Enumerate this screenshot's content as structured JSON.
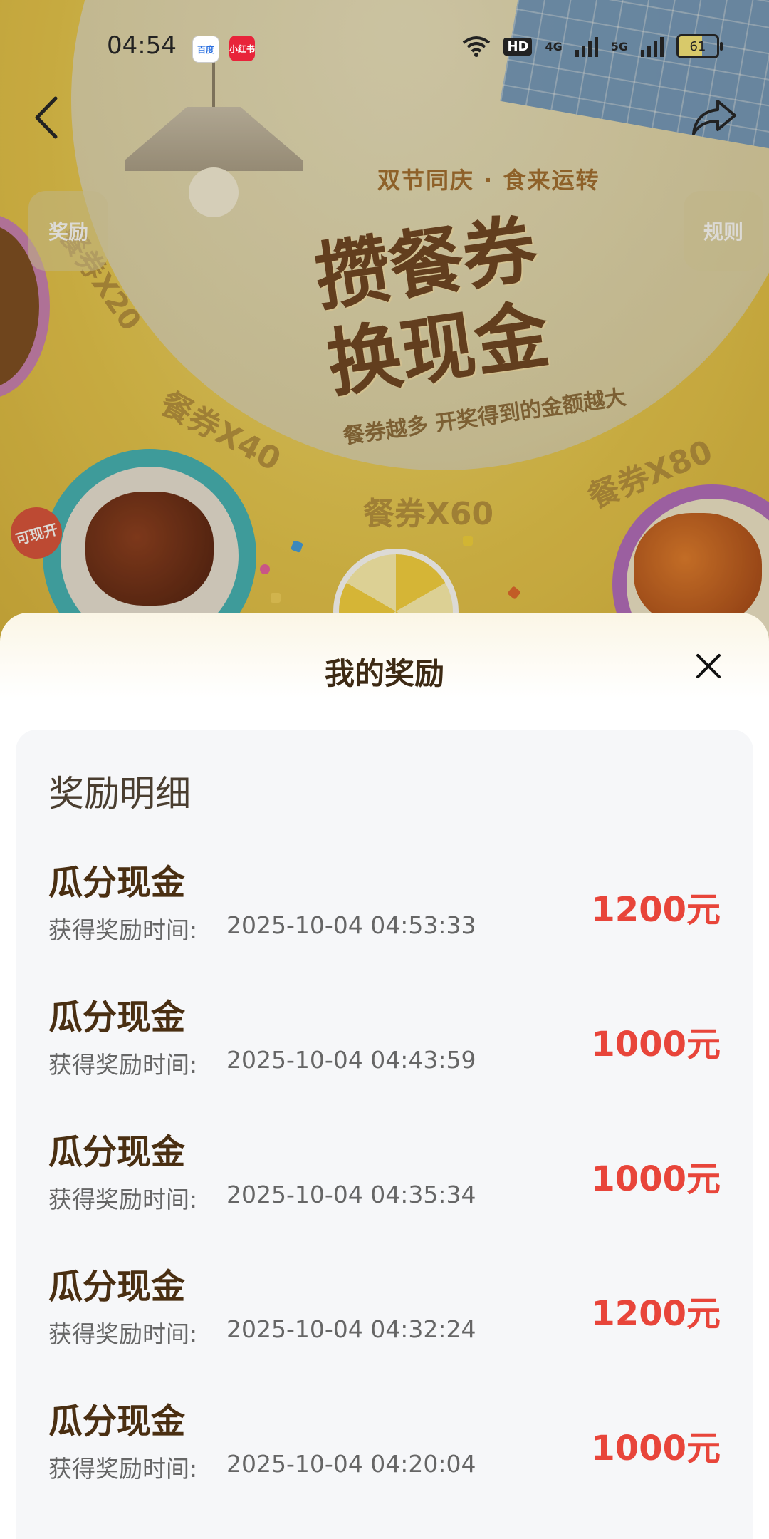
{
  "status_bar": {
    "time": "04:54",
    "apps": [
      "百度",
      "小红书"
    ],
    "network": [
      "HD",
      "4G",
      "5G"
    ],
    "battery": "61"
  },
  "banner": {
    "subtitle": "双节同庆 · 食来运转",
    "headline_line1": "攒餐券",
    "headline_line2": "换现金",
    "tagline": "餐券越多 开奖得到的金额越大",
    "left_button": "奖励",
    "right_button": "规则",
    "segments": [
      "餐券X20",
      "餐券X40",
      "餐券X60",
      "餐券X80"
    ],
    "badge": "可现开"
  },
  "sheet": {
    "title": "我的奖励",
    "panel_title": "奖励明细",
    "rewards": [
      {
        "name": "瓜分现金",
        "time_label": "获得奖励时间:",
        "time": "2025-10-04 04:53:33",
        "amount": "1200元"
      },
      {
        "name": "瓜分现金",
        "time_label": "获得奖励时间:",
        "time": "2025-10-04 04:43:59",
        "amount": "1000元"
      },
      {
        "name": "瓜分现金",
        "time_label": "获得奖励时间:",
        "time": "2025-10-04 04:35:34",
        "amount": "1000元"
      },
      {
        "name": "瓜分现金",
        "time_label": "获得奖励时间:",
        "time": "2025-10-04 04:32:24",
        "amount": "1200元"
      },
      {
        "name": "瓜分现金",
        "time_label": "获得奖励时间:",
        "time": "2025-10-04 04:20:04",
        "amount": "1000元"
      }
    ]
  },
  "colors": {
    "amount": "#e8453a",
    "title": "#3d2a14",
    "reward_name": "#4a2f12",
    "panel_bg": "#f6f7f9"
  }
}
